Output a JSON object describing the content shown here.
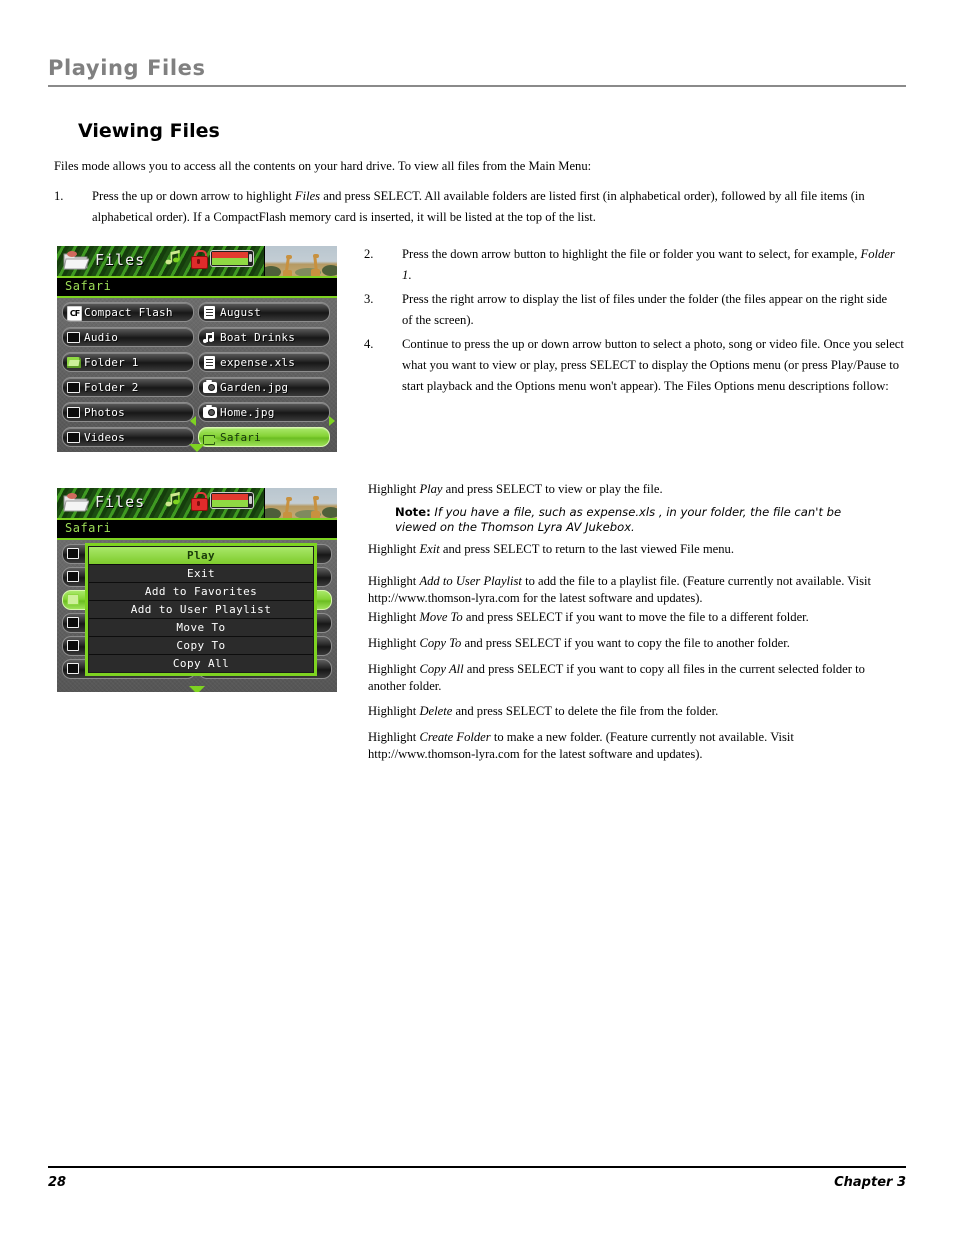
{
  "running_head": {
    "title": "Playing Files"
  },
  "section": {
    "heading": "Viewing Files"
  },
  "intro": "Files mode allows you to access all the contents on your hard drive. To view all files from the Main Menu:",
  "steps": [
    {
      "num": "1.",
      "text_a": "Press the up or down arrow to highlight ",
      "italic": "Files",
      "text_b": " and press SELECT. All available folders are listed first (in alphabetical order), followed by all file items (in alphabetical order). If a CompactFlash memory card is inserted, it will be listed at the top of the list."
    },
    {
      "num": "2.",
      "text_a": "Press the down arrow button to highlight the file or folder you want to select, for example, ",
      "italic": "Folder 1",
      "text_b": "."
    },
    {
      "num": "3.",
      "text_a": "Press the right arrow to display the list of files under the folder (the files appear on the right side of the screen).",
      "italic": "",
      "text_b": ""
    },
    {
      "num": "4.",
      "text_a": "Continue to press the up or down arrow button to select a photo, song or video file. Once you select what you want to view or play, press SELECT to display the Options menu (or press Play/Pause to start playback and the Options menu won't appear). The Files Options menu descriptions follow:",
      "italic": "",
      "text_b": ""
    }
  ],
  "option_descriptions": [
    {
      "lead": "Highlight ",
      "italic": "Play",
      "rest": " and press SELECT to view or play the file."
    },
    {
      "lead": "Highlight ",
      "italic": "Exit",
      "rest": " and press SELECT to return to the last viewed File menu."
    },
    {
      "lead": "Highlight ",
      "italic": "Add to User Playlist",
      "rest": " to add the file to a playlist file. (Feature currently not available. Visit http://www.thomson-lyra.com for the latest software and updates)."
    },
    {
      "lead": "Highlight ",
      "italic": "Move To",
      "rest": " and press SELECT if you want to move the file to a different folder."
    },
    {
      "lead": "Highlight ",
      "italic": "Copy To",
      "rest": " and press SELECT if you want to copy the file to another folder."
    },
    {
      "lead": "Highlight ",
      "italic": "Copy  All",
      "rest": " and press SELECT if you want to copy all files in the current selected folder to another folder."
    },
    {
      "lead": "Highlight ",
      "italic": "Delete",
      "rest": " and press SELECT to delete the file from the folder."
    },
    {
      "lead": "Highlight ",
      "italic": "Create Folder",
      "rest": " to make a new folder. (Feature currently not available. Visit http://www.thomson-lyra.com for the latest software and updates)."
    }
  ],
  "note": {
    "label": "Note:",
    "text": " If you have a file, such as expense.xls , in your folder, the file can't be viewed on the Thomson Lyra AV Jukebox."
  },
  "device_screen_1": {
    "title": "Files",
    "breadcrumb": "Safari",
    "status_icons": [
      "music-note-icon",
      "lock-icon",
      "battery-icon"
    ],
    "left_column": [
      {
        "label": "Compact Flash",
        "icon": "compact-flash-icon",
        "selected": false
      },
      {
        "label": "Audio",
        "icon": "folder-icon",
        "selected": false
      },
      {
        "label": "Folder 1",
        "icon": "folder-open-icon",
        "selected": false
      },
      {
        "label": "Folder 2",
        "icon": "folder-icon",
        "selected": false
      },
      {
        "label": "Photos",
        "icon": "folder-icon",
        "selected": false
      },
      {
        "label": "Videos",
        "icon": "folder-icon",
        "selected": false
      }
    ],
    "right_column": [
      {
        "label": "August",
        "icon": "document-icon",
        "selected": false
      },
      {
        "label": "Boat Drinks",
        "icon": "music-icon",
        "selected": false
      },
      {
        "label": "expense.xls",
        "icon": "document-icon",
        "selected": false
      },
      {
        "label": "Garden.jpg",
        "icon": "camera-icon",
        "selected": false
      },
      {
        "label": "Home.jpg",
        "icon": "camera-icon",
        "selected": false
      },
      {
        "label": "Safari",
        "icon": "video-camera-icon",
        "selected": true
      }
    ]
  },
  "device_screen_2": {
    "title": "Files",
    "breadcrumb": "Safari",
    "status_icons": [
      "music-note-icon",
      "lock-icon",
      "battery-icon"
    ],
    "options_menu": [
      {
        "label": "Play",
        "active": true
      },
      {
        "label": "Exit",
        "active": false
      },
      {
        "label": "Add to Favorites",
        "active": false
      },
      {
        "label": "Add to User Playlist",
        "active": false
      },
      {
        "label": "Move To",
        "active": false
      },
      {
        "label": "Copy To",
        "active": false
      },
      {
        "label": "Copy All",
        "active": false
      }
    ]
  },
  "footer": {
    "page_number": "28",
    "chapter": "Chapter 3"
  },
  "colors": {
    "accent_green": "#7ed321",
    "running_head_gray": "#808080",
    "lock_red": "#e02b2b"
  }
}
